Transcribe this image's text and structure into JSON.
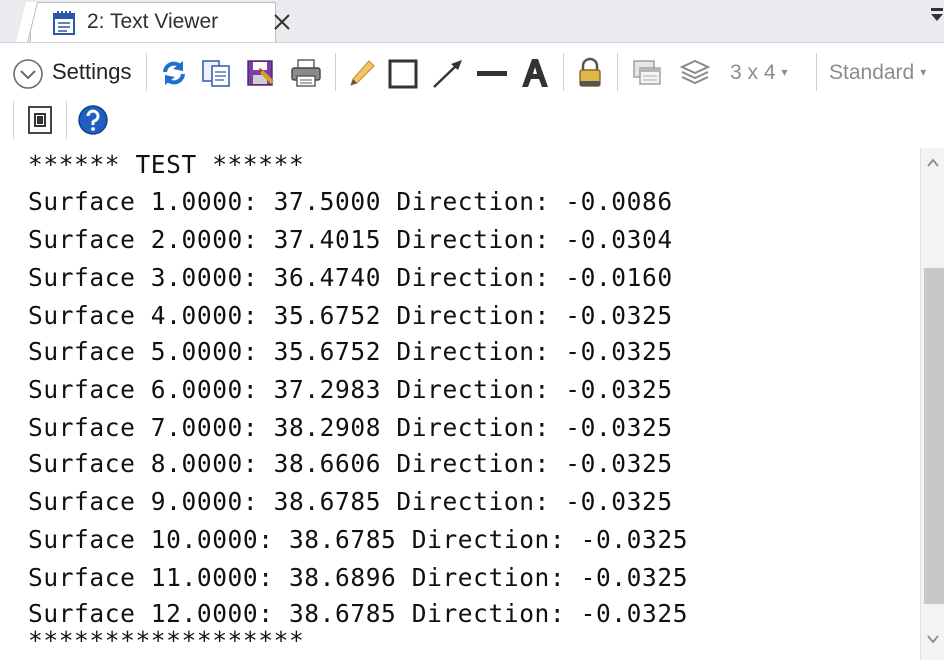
{
  "tab": {
    "title": "2: Text Viewer",
    "icon": "text-viewer-icon",
    "close_icon": "close-icon"
  },
  "toolbar": {
    "settings_label": "Settings",
    "grid_label": "3 x 4",
    "style_label": "Standard",
    "dropdown_caret": "▾"
  },
  "content": {
    "lines": [
      "****** TEST ******",
      "Surface 1.0000: 37.5000 Direction: -0.0086",
      "Surface 2.0000: 37.4015 Direction: -0.0304",
      "Surface 3.0000: 36.4740 Direction: -0.0160",
      "Surface 4.0000: 35.6752 Direction: -0.0325",
      "Surface 5.0000: 35.6752 Direction: -0.0325",
      "Surface 6.0000: 37.2983 Direction: -0.0325",
      "Surface 7.0000: 38.2908 Direction: -0.0325",
      "Surface 8.0000: 38.6606 Direction: -0.0325",
      "Surface 9.0000: 38.6785 Direction: -0.0325",
      "Surface 10.0000: 38.6785 Direction: -0.0325",
      "Surface 11.0000: 38.6896 Direction: -0.0325",
      "Surface 12.0000: 38.6785 Direction: -0.0325",
      "******************"
    ]
  },
  "colors": {
    "refresh_blue": "#1f6fd0",
    "help_blue": "#1f5fbf",
    "save_red": "#c0392b",
    "tab_border": "#b9bcc2"
  }
}
